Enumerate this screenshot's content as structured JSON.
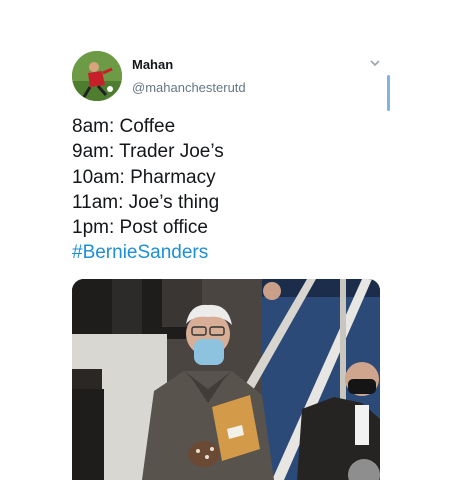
{
  "tweet": {
    "author": {
      "name": "Mahan",
      "handle": "@mahanchesterutd"
    },
    "lines": [
      "8am: Coffee",
      "9am: Trader Joe’s",
      "10am: Pharmacy",
      "11am: Joe’s thing",
      "1pm: Post office"
    ],
    "hashtag": "#BernieSanders"
  },
  "icons": {
    "menu": "chevron-down-icon"
  },
  "colors": {
    "text": "#14171a",
    "secondary": "#657786",
    "link": "#1d8fd4"
  }
}
